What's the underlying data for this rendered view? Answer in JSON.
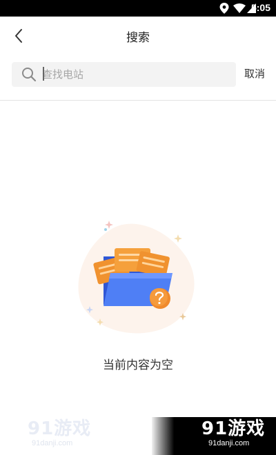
{
  "status_bar": {
    "time": "5:05",
    "icons": [
      "location-icon",
      "wifi-icon",
      "cellular-icon",
      "battery-icon"
    ]
  },
  "header": {
    "title": "搜索",
    "back_icon": "chevron-left-icon"
  },
  "search": {
    "placeholder": "查找电站",
    "value": "",
    "cancel_label": "取消",
    "icon": "search-icon"
  },
  "empty_state": {
    "message": "当前内容为空",
    "illustration": "folder-with-documents-question-icon"
  },
  "watermark": {
    "logo_text": "91游戏",
    "url": "91danji.com"
  },
  "colors": {
    "accent_orange": "#f08a2c",
    "folder_blue": "#4a78f0",
    "search_bg": "#f3f3f3",
    "blob_bg": "#fdf3ec"
  }
}
